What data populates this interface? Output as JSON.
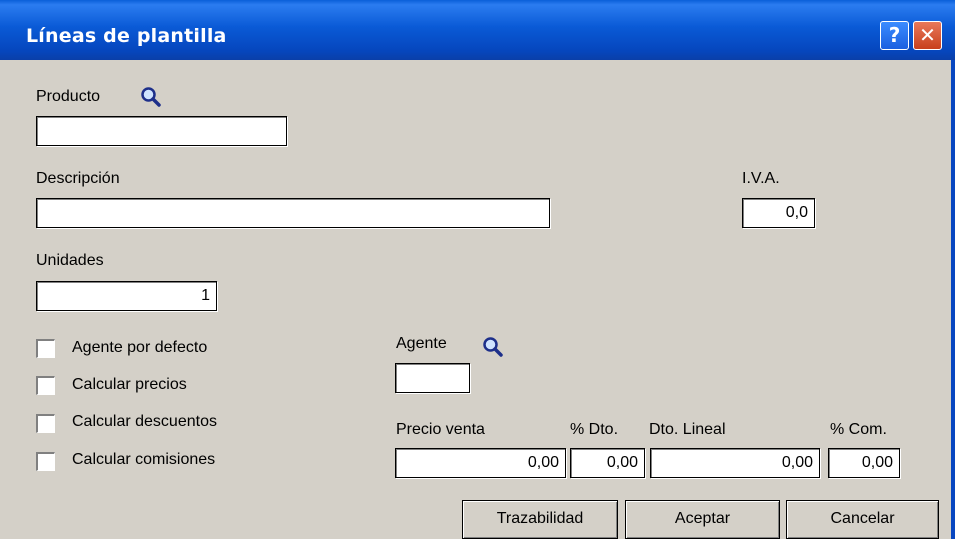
{
  "window": {
    "title": "Líneas de plantilla"
  },
  "titlebar": {
    "help_glyph": "?",
    "close_glyph": "✕"
  },
  "fields": {
    "producto": {
      "label": "Producto",
      "value": ""
    },
    "descripcion": {
      "label": "Descripción",
      "value": ""
    },
    "iva": {
      "label": "I.V.A.",
      "value": "0,0"
    },
    "unidades": {
      "label": "Unidades",
      "value": "1"
    },
    "agente": {
      "label": "Agente",
      "value": ""
    },
    "precio_venta": {
      "label": "Precio venta",
      "value": "0,00"
    },
    "dto": {
      "label": "% Dto.",
      "value": "0,00"
    },
    "dto_lineal": {
      "label": "Dto. Lineal",
      "value": "0,00"
    },
    "com": {
      "label": "% Com.",
      "value": "0,00"
    }
  },
  "checkboxes": [
    {
      "label": "Agente por defecto",
      "checked": false
    },
    {
      "label": "Calcular precios",
      "checked": false
    },
    {
      "label": "Calcular descuentos",
      "checked": false
    },
    {
      "label": "Calcular comisiones",
      "checked": false
    }
  ],
  "buttons": {
    "trazabilidad": "Trazabilidad",
    "aceptar": "Aceptar",
    "cancelar": "Cancelar"
  },
  "icons": {
    "search": "magnifier-icon"
  }
}
